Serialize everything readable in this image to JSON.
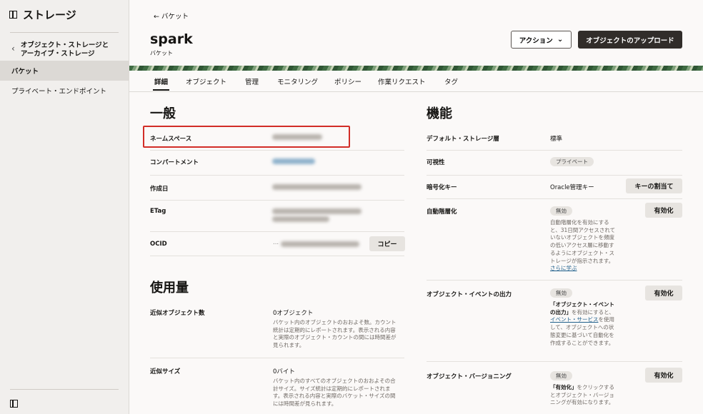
{
  "sidebar": {
    "title": "ストレージ",
    "back_label": "オブジェクト・ストレージとアーカイブ・ストレージ",
    "items": [
      {
        "label": "バケット",
        "active": true
      },
      {
        "label": "プライベート・エンドポイント",
        "active": false
      }
    ]
  },
  "header": {
    "breadcrumb": "← バケット",
    "title": "spark",
    "subtitle": "バケット",
    "action_label": "アクション",
    "upload_label": "オブジェクトのアップロード"
  },
  "tabs": [
    "詳細",
    "オブジェクト",
    "管理",
    "モニタリング",
    "ポリシー",
    "作業リクエスト",
    "タグ"
  ],
  "general": {
    "heading": "一般",
    "namespace_label": "ネームスペース",
    "compartment_label": "コンパートメント",
    "created_label": "作成日",
    "etag_label": "ETag",
    "ocid_label": "OCID",
    "ocid_value": "...",
    "copy_label": "コピー"
  },
  "usage": {
    "heading": "使用量",
    "count_label": "近似オブジェクト数",
    "count_value": "0オブジェクト",
    "count_help": "バケット内のオブジェクトのおおよそ数。カウント統計は定期的にレポートされます。表示される内容と実際のオブジェクト・カウントの間には時間差が見られます。",
    "size_label": "近似サイズ",
    "size_value": "0バイト",
    "size_help": "バケット内のすべてのオブジェクトのおおよその合計サイズ。サイズ統計は定期的にレポートされます。表示される内容と実際のバケット・サイズの間には時間差が見られます。"
  },
  "features": {
    "heading": "機能",
    "tier_label": "デフォルト・ストレージ層",
    "tier_value": "標準",
    "visibility_label": "可視性",
    "visibility_value": "プライベート",
    "encryption_label": "暗号化キー",
    "encryption_value": "Oracle管理キー",
    "assign_key_label": "キーの割当て",
    "autotier_label": "自動階層化",
    "autotier_status": "無効",
    "autotier_help": "自動階層化を有効にすると、31日間アクセスされていないオブジェクトを頻度の低いアクセス層に移動するようにオブジェクト・ストレージが指示されます。",
    "autotier_link": "さらに学ぶ",
    "events_label": "オブジェクト・イベントの出力",
    "events_status": "無効",
    "events_help_bold": "「オブジェクト・イベントの出力」",
    "events_help_1": "を有効にすると、",
    "events_link": "イベント・サービス",
    "events_help_2": "を使用して、オブジェクトへの状態変更に基づいて自動化を作成することができます。",
    "versioning_label": "オブジェクト・バージョニング",
    "versioning_status": "無効",
    "versioning_help_bold": "「有効化」",
    "versioning_help": "をクリックするとオブジェクト・バージョニングが有効になります。",
    "enable_label": "有効化"
  }
}
